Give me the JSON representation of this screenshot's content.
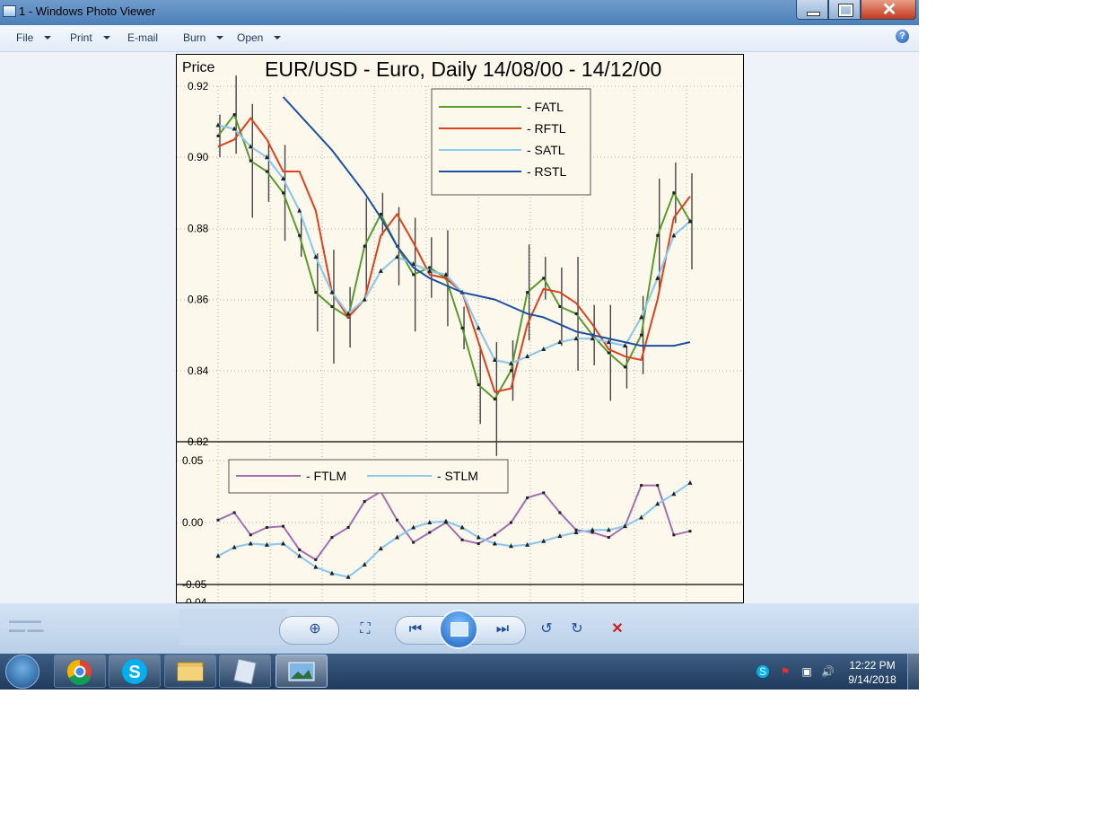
{
  "window": {
    "title": "1 - Windows Photo Viewer"
  },
  "menu": {
    "file": "File",
    "print": "Print",
    "email": "E-mail",
    "burn": "Burn",
    "open": "Open"
  },
  "chart_data": [
    {
      "type": "line",
      "title": "EUR/USD - Euro, Daily  14/08/00 - 14/12/00",
      "ylabel": "Price",
      "ylim": [
        0.82,
        0.92
      ],
      "yticks": [
        "0.92",
        "0.90",
        "0.88",
        "0.86",
        "0.84",
        "0.82"
      ],
      "legend_position": "top-right",
      "x": [
        0,
        3,
        6,
        9,
        12,
        15,
        18,
        21,
        24,
        27,
        30,
        33,
        36,
        39,
        42,
        45,
        48,
        51,
        54,
        57,
        60,
        63,
        66,
        69,
        72,
        75,
        78,
        81,
        84,
        87
      ],
      "series": [
        {
          "name": "FATL",
          "color": "#5a9a2e",
          "marker": "square",
          "values": [
            0.906,
            0.912,
            0.899,
            0.896,
            0.89,
            0.878,
            0.862,
            0.858,
            0.855,
            0.875,
            0.884,
            0.875,
            0.867,
            0.869,
            0.866,
            0.852,
            0.836,
            0.832,
            0.84,
            0.862,
            0.866,
            0.858,
            0.856,
            0.85,
            0.845,
            0.841,
            0.85,
            0.878,
            0.89,
            0.882
          ]
        },
        {
          "name": "RFTL",
          "color": "#e0401a",
          "values": [
            0.903,
            0.905,
            0.911,
            0.905,
            0.896,
            0.896,
            0.885,
            0.862,
            0.855,
            0.86,
            0.878,
            0.884,
            0.876,
            0.867,
            0.866,
            0.862,
            0.848,
            0.834,
            0.835,
            0.853,
            0.863,
            0.862,
            0.859,
            0.853,
            0.846,
            0.844,
            0.843,
            0.86,
            0.883,
            0.889
          ]
        },
        {
          "name": "SATL",
          "color": "#8ec8ec",
          "marker": "triangle",
          "values": [
            0.909,
            0.908,
            0.903,
            0.9,
            0.894,
            0.885,
            0.872,
            0.862,
            0.856,
            0.86,
            0.868,
            0.872,
            0.87,
            0.868,
            0.867,
            0.862,
            0.852,
            0.843,
            0.842,
            0.844,
            0.846,
            0.848,
            0.849,
            0.849,
            0.848,
            0.847,
            0.855,
            0.866,
            0.878,
            0.882
          ]
        },
        {
          "name": "RSTL",
          "color": "#1f4fa0",
          "values": [
            null,
            null,
            null,
            null,
            0.917,
            0.912,
            0.907,
            0.902,
            0.896,
            0.89,
            0.883,
            0.875,
            0.869,
            0.866,
            0.864,
            0.862,
            0.861,
            0.86,
            0.858,
            0.856,
            0.855,
            0.853,
            0.851,
            0.85,
            0.849,
            0.848,
            0.847,
            0.847,
            0.847,
            0.848
          ]
        }
      ]
    },
    {
      "type": "line",
      "ylim": [
        -0.05,
        0.05
      ],
      "yticks": [
        "0.05",
        "0.00",
        "-0.05",
        "-0.04"
      ],
      "legend_position": "top-left",
      "x": [
        0,
        3,
        6,
        9,
        12,
        15,
        18,
        21,
        24,
        27,
        30,
        33,
        36,
        39,
        42,
        45,
        48,
        51,
        54,
        57,
        60,
        63,
        66,
        69,
        72,
        75,
        78,
        81,
        84,
        87
      ],
      "series": [
        {
          "name": "FTLM",
          "color": "#a46fb0",
          "marker": "square",
          "values": [
            0.002,
            0.008,
            -0.01,
            -0.004,
            -0.003,
            -0.022,
            -0.03,
            -0.012,
            -0.004,
            0.017,
            0.025,
            0.002,
            -0.016,
            -0.008,
            0.0,
            -0.014,
            -0.017,
            -0.01,
            0.0,
            0.02,
            0.024,
            0.008,
            -0.006,
            -0.008,
            -0.012,
            -0.003,
            0.03,
            0.03,
            -0.01,
            -0.007
          ]
        },
        {
          "name": "STLM",
          "color": "#8ec8ec",
          "marker": "triangle",
          "values": [
            -0.027,
            -0.02,
            -0.017,
            -0.018,
            -0.017,
            -0.027,
            -0.036,
            -0.041,
            -0.044,
            -0.034,
            -0.021,
            -0.012,
            -0.004,
            0.0,
            0.001,
            -0.004,
            -0.012,
            -0.017,
            -0.019,
            -0.018,
            -0.015,
            -0.011,
            -0.008,
            -0.006,
            -0.006,
            -0.003,
            0.004,
            0.015,
            0.023,
            0.032
          ]
        }
      ]
    }
  ]
}
